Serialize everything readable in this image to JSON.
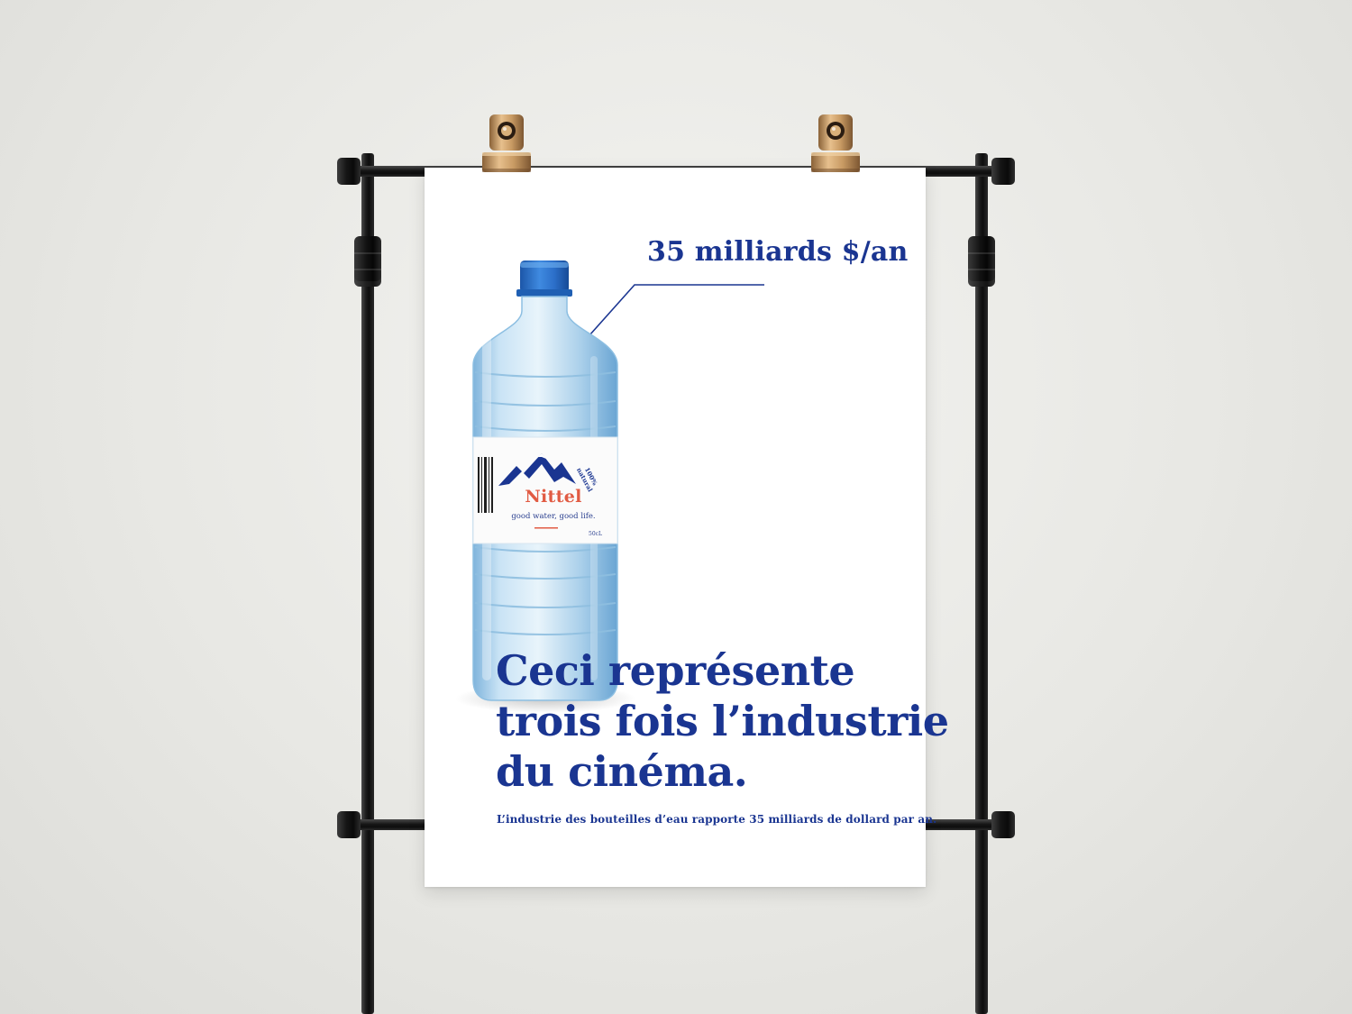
{
  "poster": {
    "callout": "35 milliards $/an",
    "headline_lines": [
      "Ceci représente",
      "trois fois l’industrie",
      "du cinéma."
    ],
    "subline": "L’industrie des bouteilles d’eau rapporte 35 milliards de dollard par an."
  },
  "bottle_label": {
    "brand": "Nittel",
    "tagline": "good water, good life.",
    "badge_line1": "100%",
    "badge_line2": "natural",
    "volume": "50cL"
  },
  "colors": {
    "headline_blue": "#1a3591",
    "brand_red": "#e15b43",
    "cap_blue": "#2c6fc9",
    "stand_black": "#111111",
    "clip_gold": "#c89a63"
  }
}
